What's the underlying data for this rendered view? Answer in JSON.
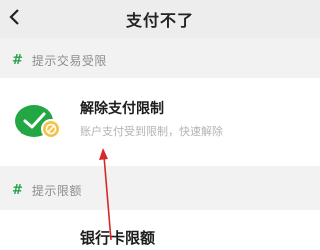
{
  "header": {
    "title": "支付不了",
    "back_icon": "back-chevron-icon"
  },
  "sections": [
    {
      "label": "提示交易受限",
      "item": {
        "title": "解除支付限制",
        "subtitle": "账户支付受到限制，快速解除",
        "icon": "wechat-pay-restricted-icon"
      }
    },
    {
      "label": "提示限额",
      "item": {
        "title": "银行卡限额"
      }
    }
  ],
  "colors": {
    "accent_green": "#2aa24a",
    "annotation_red": "#d62a2a"
  }
}
